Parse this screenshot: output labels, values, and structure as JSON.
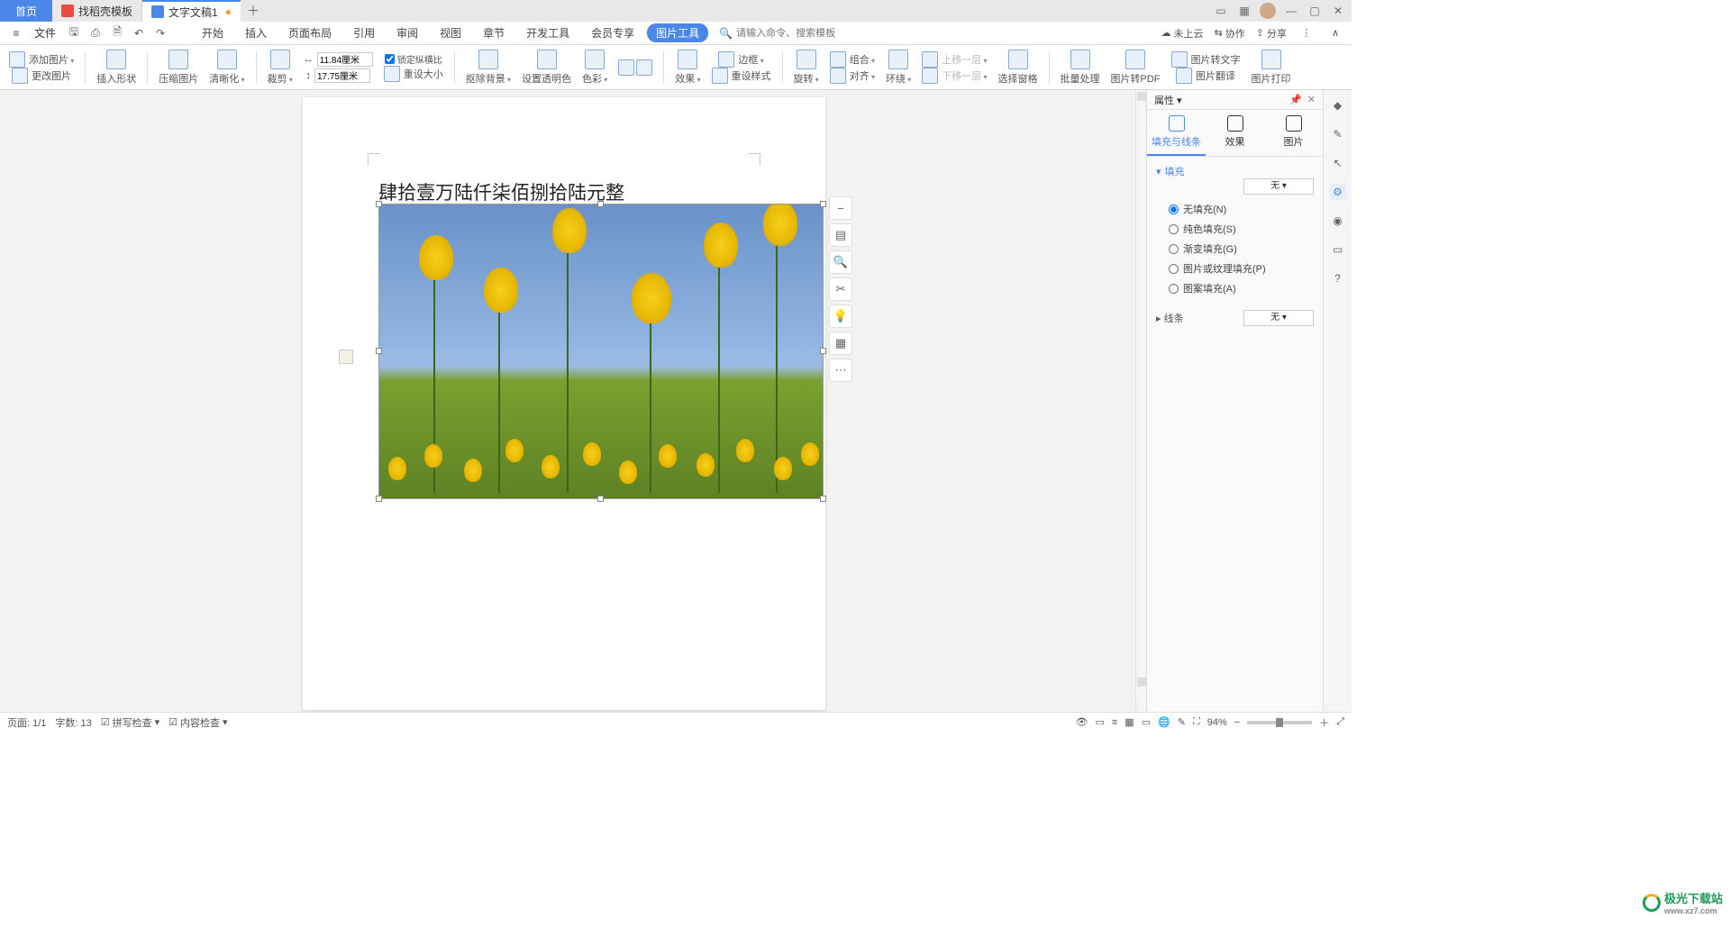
{
  "titlebar": {
    "tabs": [
      {
        "label": "首页",
        "type": "home"
      },
      {
        "label": "找稻壳模板",
        "type": "normal"
      },
      {
        "label": "文字文稿1",
        "type": "active",
        "modified": "●"
      }
    ],
    "add": "＋"
  },
  "menubar": {
    "file": "文件",
    "items": [
      "开始",
      "插入",
      "页面布局",
      "引用",
      "审阅",
      "视图",
      "章节",
      "开发工具",
      "会员专享",
      "图片工具"
    ],
    "active_index": 9,
    "search_icon": "Q",
    "search_placeholder": "请输入命令、搜索模板",
    "right": {
      "cloud": "未上云",
      "collab": "协作",
      "share": "分享"
    }
  },
  "ribbon": {
    "add_image": "添加图片",
    "change_image": "更改图片",
    "insert_shape": "插入形状",
    "compress": "压缩图片",
    "clarify": "清晰化",
    "crop": "裁剪",
    "width": "11.84厘米",
    "height": "17.75厘米",
    "lock_ratio": "锁定纵横比",
    "reset_size": "重设大小",
    "remove_bg": "抠除背景",
    "transparency": "设置透明色",
    "color": "色彩",
    "effects": "效果",
    "border": "边框",
    "reset_style": "重设样式",
    "rotate": "旋转",
    "combine": "组合",
    "align": "对齐",
    "wrap": "环绕",
    "move_up": "上移一层",
    "move_down": "下移一层",
    "select_pane": "选择窗格",
    "batch": "批量处理",
    "to_pdf": "图片转PDF",
    "to_text": "图片转文字",
    "translate": "图片翻译",
    "print": "图片打印"
  },
  "document": {
    "text_line": "肆拾壹万陆仟柒佰捌拾陆元整"
  },
  "float_toolbar": {
    "items": [
      "zoom-out",
      "layout",
      "zoom-in",
      "crop",
      "idea",
      "chart",
      "more"
    ]
  },
  "properties": {
    "title": "属性",
    "tabs": {
      "fill_line": "填充与线条",
      "effect": "效果",
      "image": "图片"
    },
    "fill_section": "填充",
    "fill_select": "无",
    "fill_options": [
      "无填充(N)",
      "纯色填充(S)",
      "渐变填充(G)",
      "图片或纹理填充(P)",
      "图案填充(A)"
    ],
    "fill_checked": 0,
    "line_section": "线条",
    "line_select": "无"
  },
  "statusbar": {
    "page": "页面: 1/1",
    "words": "字数: 13",
    "spellcheck": "拼写检查",
    "contentcheck": "内容检查",
    "zoom": "94%"
  },
  "watermark": {
    "brand": "极光下载站",
    "url": "www.xz7.com"
  }
}
